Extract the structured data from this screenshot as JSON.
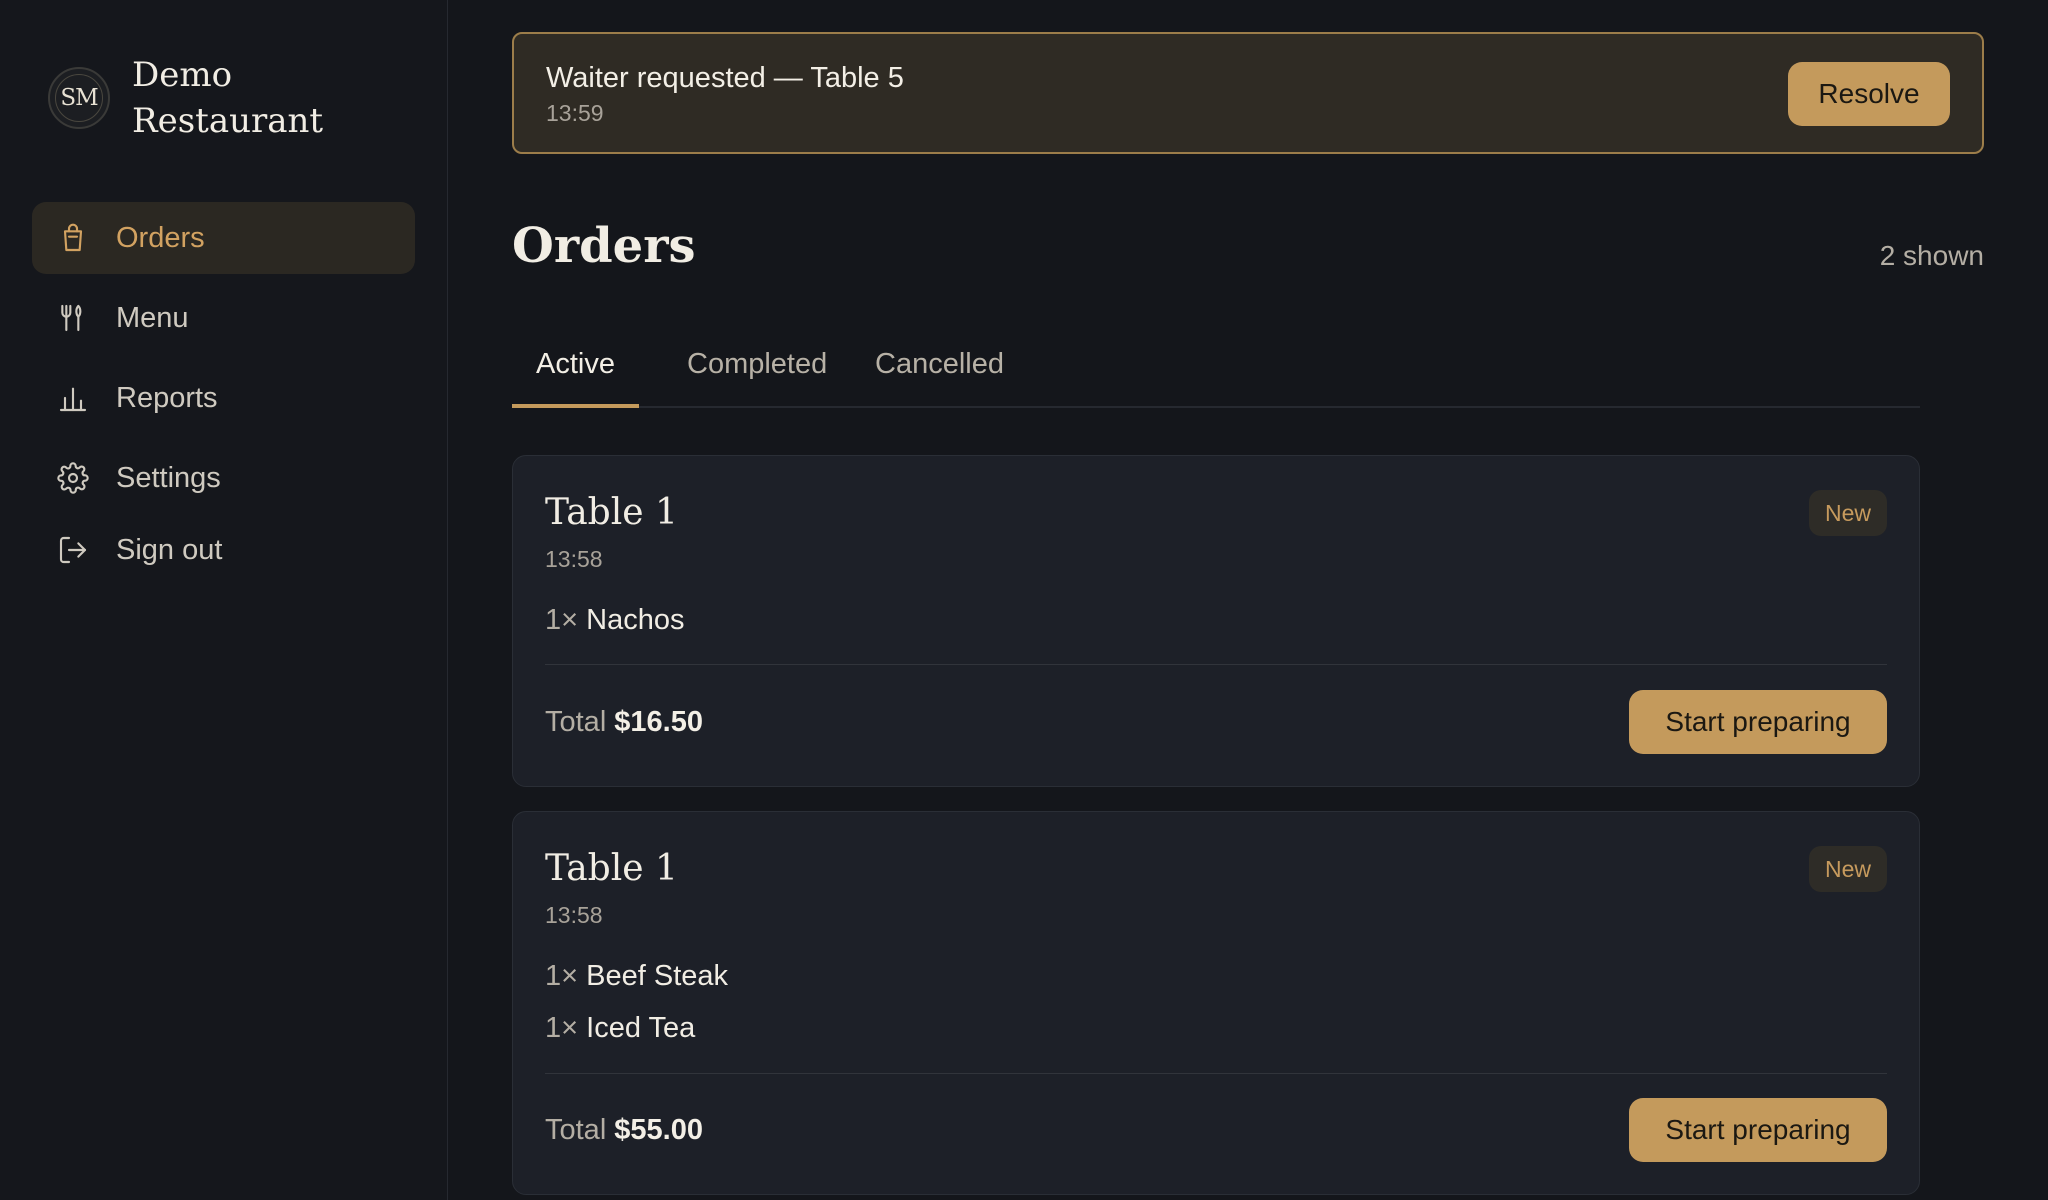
{
  "brand": {
    "logo_text": "SM",
    "name": "Demo Restaurant"
  },
  "nav": {
    "items": [
      {
        "label": "Orders",
        "icon": "shopping-bag-icon",
        "active": true
      },
      {
        "label": "Menu",
        "icon": "utensils-icon",
        "active": false
      },
      {
        "label": "Reports",
        "icon": "bar-chart-icon",
        "active": false
      },
      {
        "label": "Settings",
        "icon": "gear-icon",
        "active": false
      },
      {
        "label": "Sign out",
        "icon": "sign-out-icon",
        "active": false
      }
    ]
  },
  "alert": {
    "title": "Waiter requested — Table 5",
    "time": "13:59",
    "action": "Resolve"
  },
  "page": {
    "title": "Orders",
    "count": "2 shown"
  },
  "tabs": [
    {
      "label": "Active",
      "active": true
    },
    {
      "label": "Completed",
      "active": false
    },
    {
      "label": "Cancelled",
      "active": false
    }
  ],
  "orders": [
    {
      "table": "Table 1",
      "time": "13:58",
      "status": "New",
      "items": [
        {
          "qty": "1×",
          "name": "Nachos"
        }
      ],
      "total_label": "Total",
      "total": "$16.50",
      "action": "Start preparing"
    },
    {
      "table": "Table 1",
      "time": "13:58",
      "status": "New",
      "items": [
        {
          "qty": "1×",
          "name": "Beef Steak"
        },
        {
          "qty": "1×",
          "name": "Iced Tea"
        }
      ],
      "total_label": "Total",
      "total": "$55.00",
      "action": "Start preparing"
    }
  ],
  "colors": {
    "accent": "#c49a5c",
    "background": "#14161b",
    "card": "#1d2028",
    "alert_bg": "#2f2b24"
  }
}
